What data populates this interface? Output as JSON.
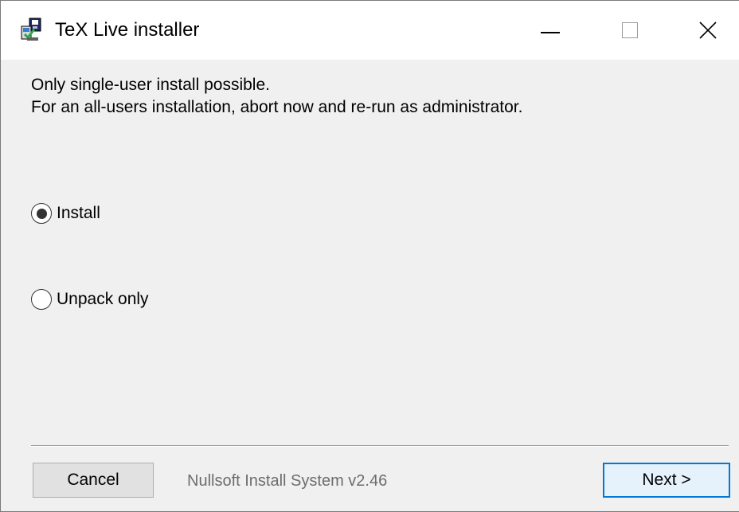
{
  "window": {
    "title": "TeX Live installer",
    "controls": {
      "minimize": "minimize-icon",
      "maximize": "maximize-icon",
      "close": "close-icon"
    }
  },
  "message": {
    "line1": "Only single-user install possible.",
    "line2": "For an all-users installation, abort now and re-run as administrator."
  },
  "options": [
    {
      "label": "Install",
      "selected": true
    },
    {
      "label": "Unpack only",
      "selected": false
    }
  ],
  "footer": {
    "cancel_label": "Cancel",
    "branding": "Nullsoft Install System v2.46",
    "next_label": "Next >"
  },
  "colors": {
    "titlebar": "#ffffff",
    "client": "#f0f0f0",
    "accent": "#0078d7",
    "branding_text": "#6d6d6d"
  }
}
